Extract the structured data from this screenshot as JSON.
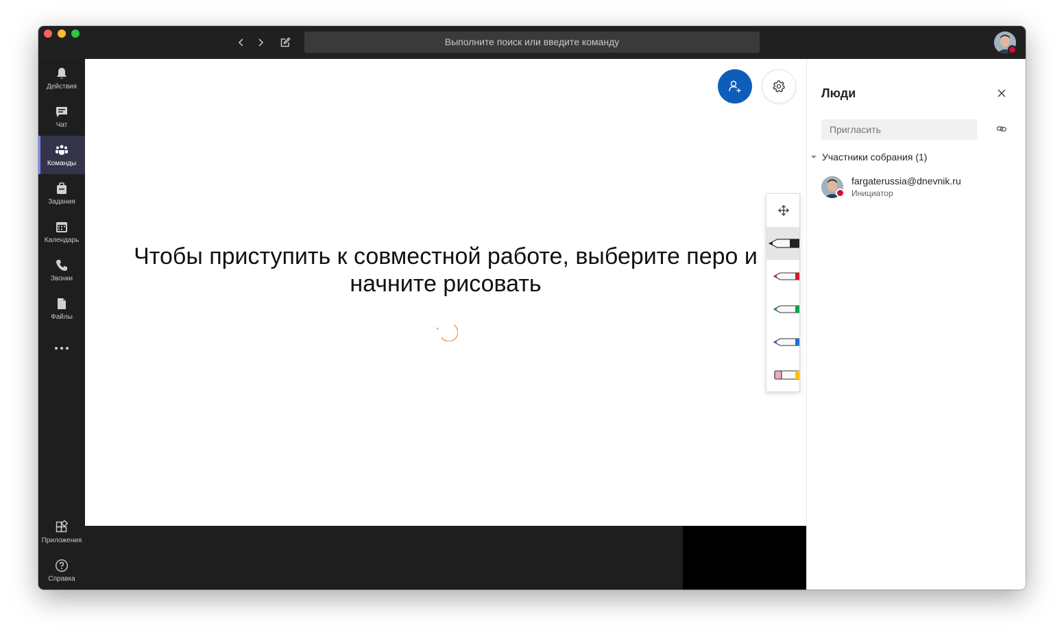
{
  "titlebar": {
    "search_placeholder": "Выполните поиск или введите команду"
  },
  "sidebar": {
    "items": [
      {
        "label": "Действия",
        "icon": "bell-icon"
      },
      {
        "label": "Чат",
        "icon": "chat-icon"
      },
      {
        "label": "Команды",
        "icon": "teams-icon",
        "active": true
      },
      {
        "label": "Задания",
        "icon": "assignments-icon"
      },
      {
        "label": "Календарь",
        "icon": "calendar-icon"
      },
      {
        "label": "Звонки",
        "icon": "phone-icon"
      },
      {
        "label": "Файлы",
        "icon": "files-icon"
      }
    ],
    "bottom_items": [
      {
        "label": "Приложения",
        "icon": "apps-icon"
      },
      {
        "label": "Справка",
        "icon": "help-icon"
      }
    ]
  },
  "whiteboard": {
    "hint": "Чтобы приступить к совместной работе, выберите перо и начните рисовать",
    "pens": [
      {
        "name": "black-pen",
        "color": "#222222"
      },
      {
        "name": "red-pen",
        "color": "#e81123"
      },
      {
        "name": "green-pen",
        "color": "#10a04a"
      },
      {
        "name": "blue-pen",
        "color": "#1e6fd9"
      },
      {
        "name": "eraser",
        "color": "#f4a6c8"
      }
    ]
  },
  "people_panel": {
    "title": "Люди",
    "invite_placeholder": "Пригласить",
    "section_label": "Участники собрания (1)",
    "participants": [
      {
        "name": "fargaterussia@dnevnik.ru",
        "role": "Инициатор"
      }
    ]
  },
  "colors": {
    "accent": "#0f5dbb",
    "sidebar_active": "#33344a",
    "status_busy": "#d0103a"
  }
}
